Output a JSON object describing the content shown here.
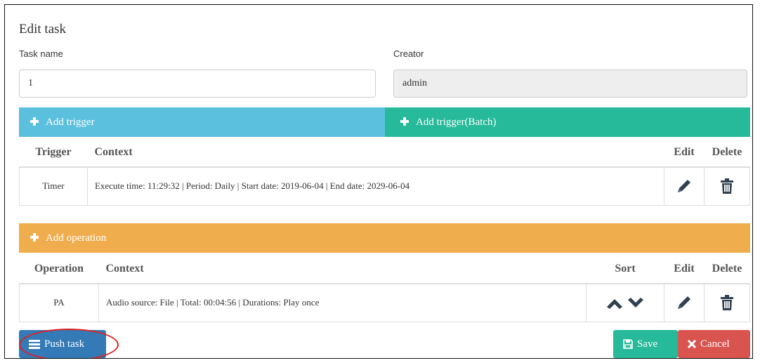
{
  "dialog": {
    "title": "Edit task"
  },
  "form": {
    "task_name_label": "Task name",
    "task_name_value": "1",
    "creator_label": "Creator",
    "creator_value": "admin"
  },
  "triggers": {
    "add_label": "Add trigger",
    "add_batch_label": "Add trigger(Batch)",
    "columns": {
      "trigger": "Trigger",
      "context": "Context",
      "edit": "Edit",
      "delete": "Delete"
    },
    "rows": [
      {
        "trigger": "Timer",
        "context": "Execute time: 11:29:32 | Period: Daily | Start date: 2019-06-04 | End date: 2029-06-04"
      }
    ]
  },
  "operations": {
    "add_label": "Add operation",
    "columns": {
      "operation": "Operation",
      "context": "Context",
      "sort": "Sort",
      "edit": "Edit",
      "delete": "Delete"
    },
    "rows": [
      {
        "operation": "PA",
        "context": "Audio source: File | Total: 00:04:56 | Durations: Play once"
      }
    ]
  },
  "footer": {
    "push_label": "Push task",
    "save_label": "Save",
    "cancel_label": "Cancel"
  },
  "colors": {
    "trigger_bar": "#5bc0de",
    "batch_bar": "#26b99a",
    "operation_bar": "#f0ad4e",
    "push_button": "#337ab7",
    "save_button": "#26b99a",
    "cancel_button": "#d9534f",
    "icon": "#2f4050",
    "annotation": "#e0201f"
  },
  "icons": {
    "edit": "pencil-icon",
    "delete": "trash-icon",
    "sort_up": "chevron-up-icon",
    "sort_down": "chevron-down-icon",
    "push": "list-icon",
    "save": "floppy-icon",
    "cancel": "close-icon"
  }
}
